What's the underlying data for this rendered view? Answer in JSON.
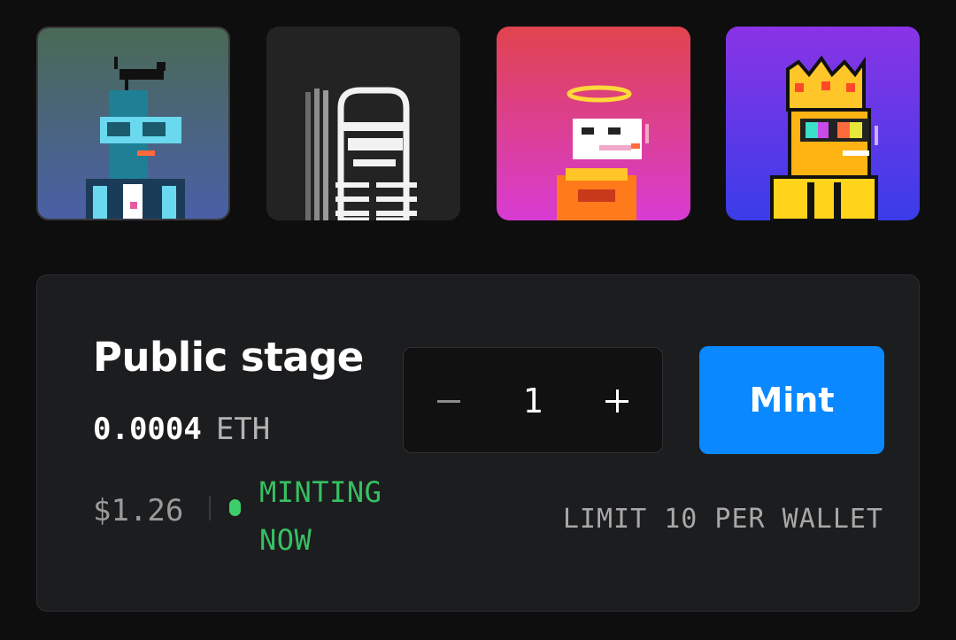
{
  "gallery": {
    "items": [
      {
        "name": "nft-1",
        "icon": "pixel-art-character-cat-hat"
      },
      {
        "name": "nft-2",
        "icon": "pixel-art-character-monochrome"
      },
      {
        "name": "nft-3",
        "icon": "pixel-art-character-halo"
      },
      {
        "name": "nft-4",
        "icon": "pixel-art-character-crown"
      }
    ]
  },
  "stage": {
    "title": "Public stage",
    "price": "0.0004",
    "currency": "ETH",
    "usd_price": "$1.26",
    "status": "MINTING NOW",
    "quantity": "1",
    "mint_label": "Mint",
    "limit": "LIMIT 10 PER WALLET"
  },
  "colors": {
    "accent": "#0a88ff",
    "status": "#37c062",
    "card_bg": "#1c1d1f",
    "page_bg": "#0e0e0f"
  }
}
